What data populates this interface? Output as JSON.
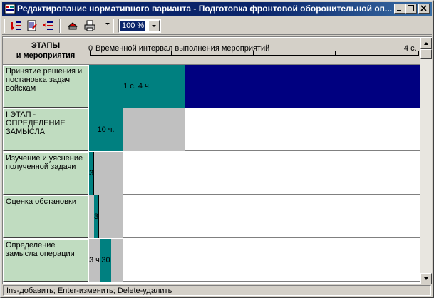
{
  "window": {
    "title": "Редактирование нормативного варианта - Подготовка фронтовой оборонительной оп..."
  },
  "toolbar": {
    "icons": [
      "insert-stage-icon",
      "edit-doc-icon",
      "delete-stage-icon",
      "print-preview-icon",
      "print-icon"
    ],
    "zoom_value": "100 %"
  },
  "header": {
    "left_line1": "ЭТАПЫ",
    "left_line2": "и мероприятия",
    "ruler_zero": "0",
    "ruler_label": "Временной интервал выполнения мероприятий",
    "ruler_end": "4 с."
  },
  "rows": [
    {
      "label": "Принятие решения и постановка задач войскам",
      "bar_label": "1 с. 4 ч.",
      "pre_label": ""
    },
    {
      "label": "I ЭТАП - ОПРЕДЕЛЕНИЕ ЗАМЫСЛА",
      "bar_label": "10 ч.",
      "pre_label": ""
    },
    {
      "label": "Изучение и уяснение полученной задачи",
      "bar_label": "3",
      "pre_label": ""
    },
    {
      "label": "Оценка обстановки",
      "bar_label": "3",
      "pre_label": ""
    },
    {
      "label": "Определение замысла операции",
      "bar_label": "30",
      "pre_label": "3 ч."
    }
  ],
  "statusbar": {
    "text": "Ins-добавить; Enter-изменить; Delete-удалить"
  },
  "colors": {
    "titlebar": "#0a246a",
    "bar": "#008080",
    "background_span": "#000080",
    "label_cell": "#c0dcc0",
    "gray_span": "#c0c0c0"
  }
}
